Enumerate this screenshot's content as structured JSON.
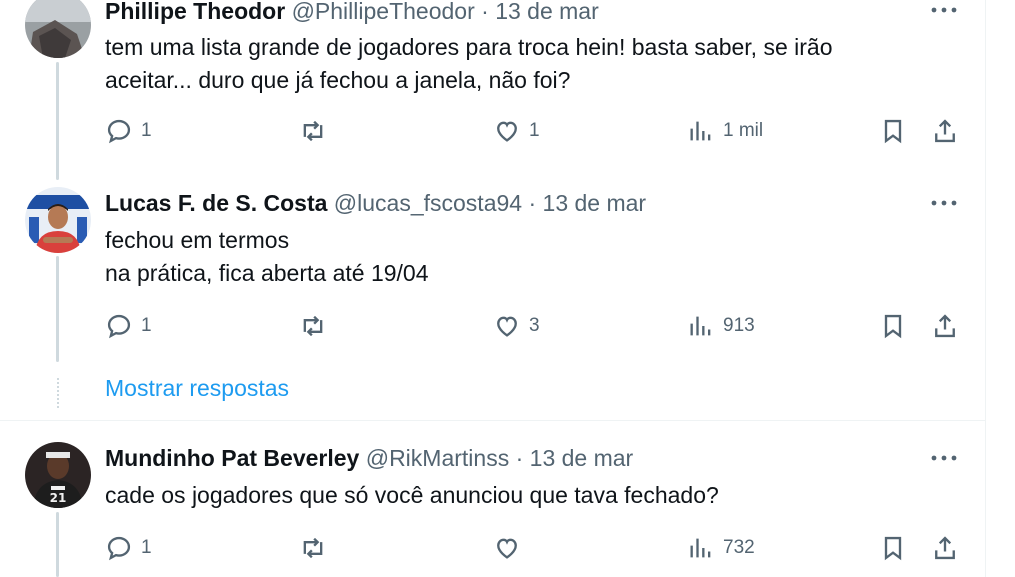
{
  "tweets": [
    {
      "name": "Phillipe Theodor",
      "handle": "@PhillipeTheodor",
      "separator": "·",
      "date": "13 de mar",
      "text": "tem uma lista grande de jogadores para troca hein! basta saber, se irão\naceitar... duro que já fechou a janela, não foi?",
      "replies": "1",
      "retweets": "",
      "likes": "1",
      "views": "1 mil"
    },
    {
      "name": "Lucas F. de S. Costa",
      "handle": "@lucas_fscosta94",
      "separator": "·",
      "date": "13 de mar",
      "text": "fechou em termos\nna prática, fica aberta até 19/04",
      "replies": "1",
      "retweets": "",
      "likes": "3",
      "views": "913"
    },
    {
      "name": "Mundinho Pat Beverley",
      "handle": "@RikMartinss",
      "separator": "·",
      "date": "13 de mar",
      "text": "cade os jogadores que só você anunciou que tava fechado?",
      "replies": "1",
      "retweets": "",
      "likes": "",
      "views": "732"
    }
  ],
  "show_replies_label": "Mostrar respostas",
  "colors": {
    "accent": "#1d9bf0",
    "muted": "#536471",
    "text": "#0f1419",
    "divider": "#eff3f4"
  },
  "icons": [
    "reply-icon",
    "retweet-icon",
    "like-icon",
    "views-icon",
    "bookmark-icon",
    "share-icon",
    "more-icon"
  ]
}
